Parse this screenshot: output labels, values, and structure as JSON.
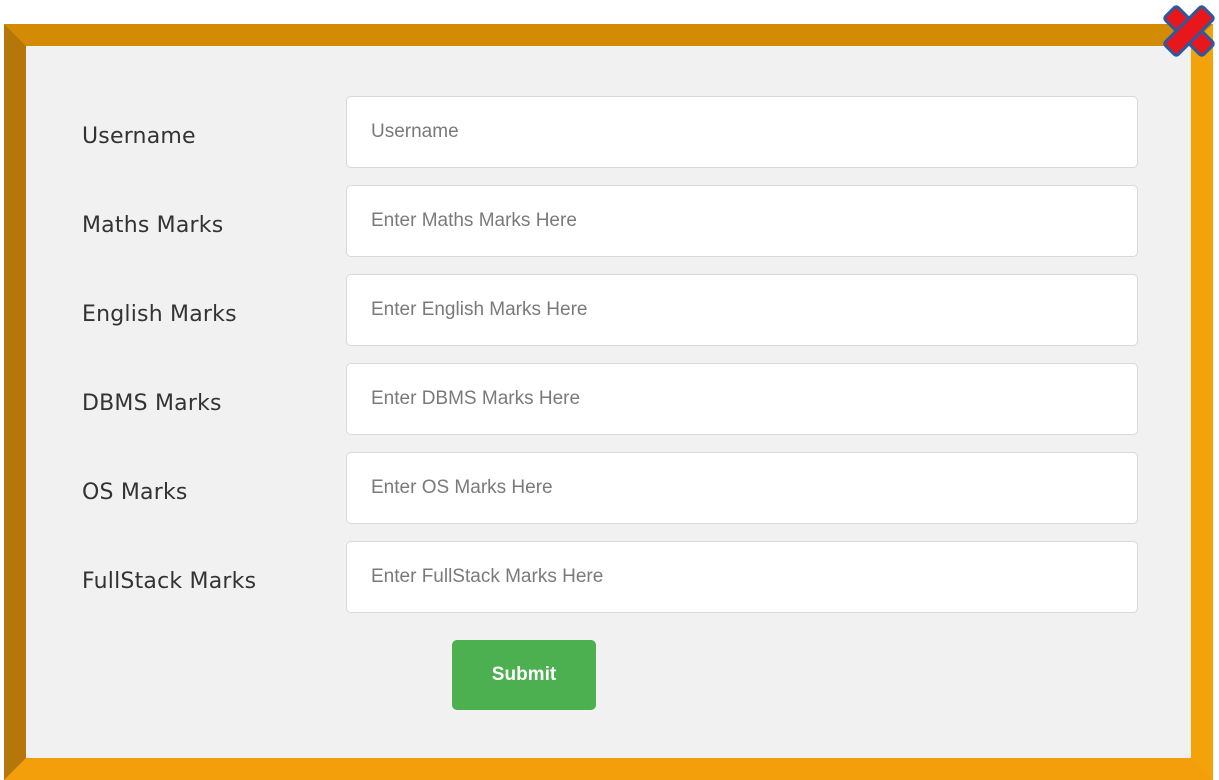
{
  "form": {
    "fields": [
      {
        "label": "Username",
        "placeholder": "Username",
        "value": ""
      },
      {
        "label": "Maths Marks",
        "placeholder": "Enter Maths Marks Here",
        "value": ""
      },
      {
        "label": "English Marks",
        "placeholder": "Enter English Marks Here",
        "value": ""
      },
      {
        "label": "DBMS Marks",
        "placeholder": "Enter DBMS Marks Here",
        "value": ""
      },
      {
        "label": "OS Marks",
        "placeholder": "Enter OS Marks Here",
        "value": ""
      },
      {
        "label": "FullStack Marks",
        "placeholder": "Enter FullStack Marks Here",
        "value": ""
      }
    ],
    "submit_label": "Submit"
  },
  "icons": {
    "close": "close-x-icon"
  },
  "colors": {
    "frame_orange": "#f4a20a",
    "frame_dark": "#b5760a",
    "panel_bg": "#f1f1f1",
    "submit_green": "#4caf50",
    "close_red": "#e8171c",
    "close_outline": "#2b5aa0"
  }
}
